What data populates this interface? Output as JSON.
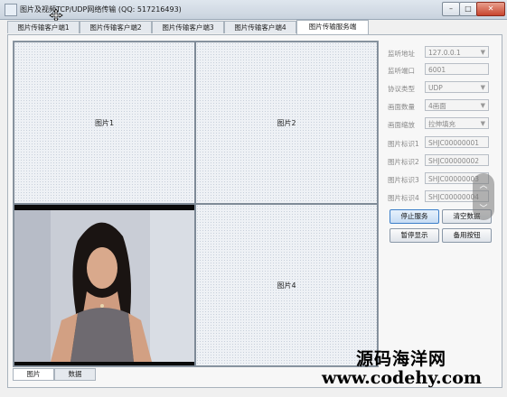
{
  "window": {
    "title": "图片及视频TCP/UDP网络传输 (QQ: 517216493)",
    "controls": {
      "minimize": "–",
      "maximize": "□",
      "close": "✕"
    }
  },
  "tabs": [
    {
      "label": "图片传输客户端1",
      "active": false
    },
    {
      "label": "图片传输客户端2",
      "active": false
    },
    {
      "label": "图片传输客户端3",
      "active": false
    },
    {
      "label": "图片传输客户端4",
      "active": false
    },
    {
      "label": "图片传输服务端",
      "active": true
    }
  ],
  "grid": {
    "cells": [
      {
        "label": "图片1",
        "has_video": false
      },
      {
        "label": "图片2",
        "has_video": false
      },
      {
        "label": "",
        "has_video": true
      },
      {
        "label": "图片4",
        "has_video": false
      }
    ]
  },
  "settings": [
    {
      "label": "监听地址",
      "value": "127.0.0.1",
      "dropdown": true
    },
    {
      "label": "监听端口",
      "value": "6001",
      "dropdown": false
    },
    {
      "label": "协议类型",
      "value": "UDP",
      "dropdown": true
    },
    {
      "label": "画面数量",
      "value": "4画面",
      "dropdown": true
    },
    {
      "label": "画面缩放",
      "value": "拉伸填充",
      "dropdown": true
    },
    {
      "label": "图片标识1",
      "value": "SHJC00000001",
      "dropdown": false
    },
    {
      "label": "图片标识2",
      "value": "SHJC00000002",
      "dropdown": false
    },
    {
      "label": "图片标识3",
      "value": "SHJC00000003",
      "dropdown": false
    },
    {
      "label": "图片标识4",
      "value": "SHJC00000004",
      "dropdown": false
    }
  ],
  "buttons": {
    "stop_service": "停止服务",
    "clear_data": "清空数据",
    "pause_display": "暂停显示",
    "spare_button": "备用按钮"
  },
  "bottom_tabs": [
    {
      "label": "图片",
      "active": true
    },
    {
      "label": "数据",
      "active": false
    }
  ],
  "watermark": {
    "line1": "源码海洋网",
    "line2": "www.codehy.com"
  },
  "colors": {
    "titlebar": "#c9d3de",
    "accent": "#3d7fc9",
    "close_button": "#c8452e"
  }
}
